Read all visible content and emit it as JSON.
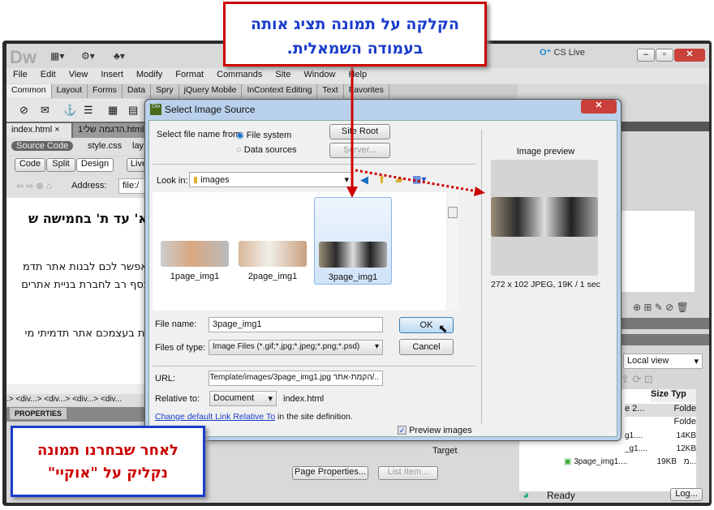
{
  "app": {
    "logo": "Dw",
    "cs_live": "CS Live"
  },
  "menu": [
    "File",
    "Edit",
    "View",
    "Insert",
    "Modify",
    "Format",
    "Commands",
    "Site",
    "Window",
    "Help"
  ],
  "insert_tabs": [
    "Common",
    "Layout",
    "Forms",
    "Data",
    "Spry",
    "jQuery Mobile",
    "InContext Editing",
    "Text",
    "Favorites"
  ],
  "doc_tabs": [
    "index.html",
    "הדגמה שלי1.html"
  ],
  "related": {
    "source": "Source Code",
    "file1": "style.css",
    "file2": "lay"
  },
  "view_buttons": [
    "Code",
    "Split",
    "Design",
    "Live"
  ],
  "address": {
    "label": "Address:",
    "value": "file:/"
  },
  "content": {
    "heading": "א' עד ת' בחמישה ש",
    "p1": "אפשר לכם לבנות אתר תדמ",
    "p2": "נסף רב לחברת בניית אתרים",
    "p3": "ות בעצמכם אתר תדמיתי מי"
  },
  "tag_selector": ".> <div...> <div...> <div...> <div...",
  "properties": {
    "title": "PROPERTIES",
    "page_properties": "Page Properties...",
    "list_item": "List Item...",
    "target": "Target"
  },
  "right_panel": {
    "view": "Local view",
    "col_size": "Size",
    "col_type": "Typ",
    "rows": [
      {
        "name": "e 2...",
        "size": "",
        "type": "Folde"
      },
      {
        "name": "",
        "size": "",
        "type": "Folde"
      },
      {
        "name": "g1....",
        "size": "14KB",
        "type": "מ..."
      },
      {
        "name": "_g1....",
        "size": "12KB",
        "type": "מ..."
      },
      {
        "name": "3page_img1....",
        "size": "19KB",
        "type": "מ..."
      }
    ],
    "partial": "ea",
    "status": "Ready",
    "log": "Log..."
  },
  "dialog": {
    "title": "Select Image Source",
    "select_from": "Select file name from:",
    "opt_fs": "File system",
    "opt_ds": "Data sources",
    "selected": "File system",
    "site_root": "Site Root",
    "server": "Server...",
    "look_in_label": "Look in:",
    "look_in": "images",
    "files": [
      {
        "name": "1page_img1"
      },
      {
        "name": "2page_img1"
      },
      {
        "name": "3page_img1",
        "selected": true
      }
    ],
    "file_name_label": "File name:",
    "file_name": "3page_img1",
    "type_label": "Files of type:",
    "type": "Image Files (*.gif;*.jpg;*.jpeg;*.png;*.psd)",
    "ok": "OK",
    "cancel": "Cancel",
    "url_label": "URL:",
    "url": "../הקמת-אתר Template/images/3page_img1.jpg",
    "relative_label": "Relative to:",
    "relative": "Document",
    "relative_file": "index.html",
    "link": "Change default Link Relative To",
    "link_suffix": "in the site definition.",
    "preview_images": "Preview images",
    "preview_checked": true,
    "preview_title": "Image preview",
    "preview_info": "272 x 102 JPEG, 19K / 1 sec"
  },
  "callouts": {
    "top_line1": "הקלקה על תמונה תציג אותה",
    "top_line2": "בעמודה השמאלית.",
    "bottom_line1": "לאחר שבחרנו תמונה",
    "bottom_line2": "נקליק על \"אוקיי\""
  },
  "colors": {
    "callout_red": "#cc0000",
    "callout_blue": "#1a3ccc"
  }
}
